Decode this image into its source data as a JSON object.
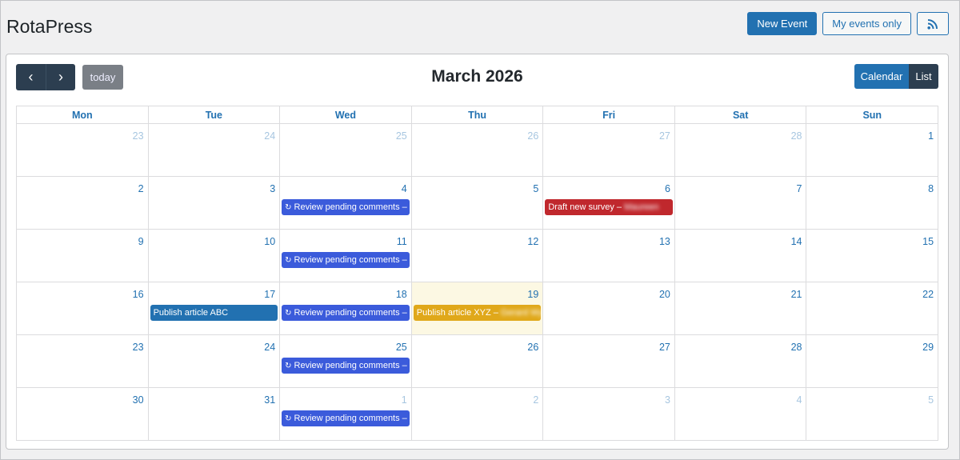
{
  "app": {
    "title": "RotaPress"
  },
  "actions": {
    "new_event": "New Event",
    "my_events": "My events only",
    "rss_icon": "rss-icon"
  },
  "toolbar": {
    "prev_icon": "‹",
    "next_icon": "›",
    "today": "today",
    "month": "March 2026",
    "view_calendar": "Calendar",
    "view_list": "List"
  },
  "weekdays": [
    "Mon",
    "Tue",
    "Wed",
    "Thu",
    "Fri",
    "Sat",
    "Sun"
  ],
  "weeks": [
    [
      {
        "n": "23",
        "other": true
      },
      {
        "n": "24",
        "other": true
      },
      {
        "n": "25",
        "other": true
      },
      {
        "n": "26",
        "other": true
      },
      {
        "n": "27",
        "other": true
      },
      {
        "n": "28",
        "other": true
      },
      {
        "n": "1"
      }
    ],
    [
      {
        "n": "2"
      },
      {
        "n": "3"
      },
      {
        "n": "4",
        "event": {
          "label": "Review pending comments – L",
          "color": "#3b5bdb",
          "repeat": true
        }
      },
      {
        "n": "5"
      },
      {
        "n": "6",
        "event": {
          "label": "Draft new survey – ",
          "blurred": "Maureen",
          "color": "#c0282d"
        }
      },
      {
        "n": "7"
      },
      {
        "n": "8"
      }
    ],
    [
      {
        "n": "9"
      },
      {
        "n": "10"
      },
      {
        "n": "11",
        "event": {
          "label": "Review pending comments – L",
          "color": "#3b5bdb",
          "repeat": true
        }
      },
      {
        "n": "12"
      },
      {
        "n": "13"
      },
      {
        "n": "14"
      },
      {
        "n": "15"
      }
    ],
    [
      {
        "n": "16"
      },
      {
        "n": "17",
        "event": {
          "label": "Publish article ABC",
          "color": "#2271b1"
        }
      },
      {
        "n": "18",
        "event": {
          "label": "Review pending comments – L",
          "color": "#3b5bdb",
          "repeat": true
        }
      },
      {
        "n": "19",
        "today": true,
        "event": {
          "label": "Publish article XYZ – ",
          "blurred": "Gerard Wyn",
          "color": "#e0a81a"
        }
      },
      {
        "n": "20"
      },
      {
        "n": "21"
      },
      {
        "n": "22"
      }
    ],
    [
      {
        "n": "23"
      },
      {
        "n": "24"
      },
      {
        "n": "25",
        "event": {
          "label": "Review pending comments – L",
          "color": "#3b5bdb",
          "repeat": true
        }
      },
      {
        "n": "26"
      },
      {
        "n": "27"
      },
      {
        "n": "28"
      },
      {
        "n": "29"
      }
    ],
    [
      {
        "n": "30"
      },
      {
        "n": "31"
      },
      {
        "n": "1",
        "other": true,
        "event": {
          "label": "Review pending comments – L",
          "color": "#3b5bdb",
          "repeat": true
        }
      },
      {
        "n": "2",
        "other": true
      },
      {
        "n": "3",
        "other": true
      },
      {
        "n": "4",
        "other": true
      },
      {
        "n": "5",
        "other": true
      }
    ]
  ]
}
